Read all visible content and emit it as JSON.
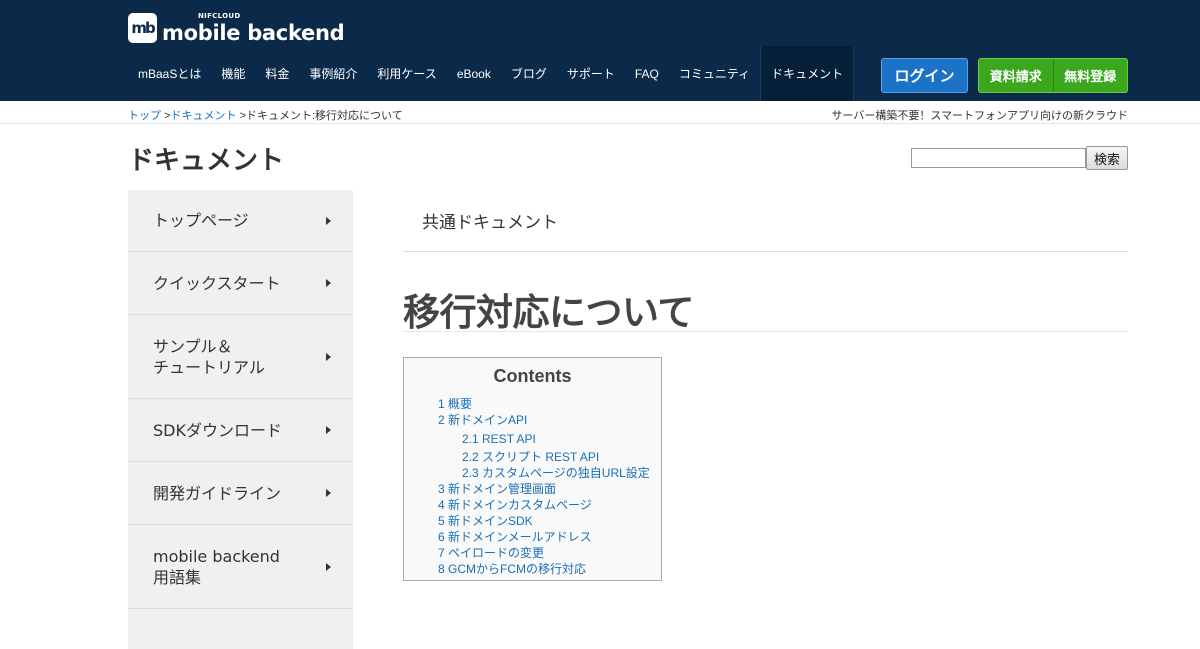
{
  "header": {
    "logo_mark": "mb",
    "logo_small": "NIFCLOUD",
    "logo_big": "mobile backend",
    "nav": [
      {
        "label": "mBaaSとは"
      },
      {
        "label": "機能"
      },
      {
        "label": "料金"
      },
      {
        "label": "事例紹介"
      },
      {
        "label": "利用ケース"
      },
      {
        "label": "eBook"
      },
      {
        "label": "ブログ"
      },
      {
        "label": "サポート"
      },
      {
        "label": "FAQ"
      },
      {
        "label": "コミュニティ"
      },
      {
        "label": "ドキュメント",
        "active": true
      }
    ],
    "login_label": "ログイン",
    "request_label": "資料請求",
    "signup_label": "無料登録"
  },
  "breadcrumb": {
    "items": [
      "トップ",
      "ドキュメント",
      "ドキュメント:移行対応について"
    ],
    "separator": ">",
    "tagline": "サーバー構築不要！スマートフォンアプリ向けの新クラウド"
  },
  "page": {
    "title": "ドキュメント",
    "search_button": "検索",
    "search_value": ""
  },
  "sidebar": {
    "items": [
      {
        "label": "トップページ"
      },
      {
        "label": "クイックスタート"
      },
      {
        "label": "サンプル＆\nチュートリアル"
      },
      {
        "label": "SDKダウンロード"
      },
      {
        "label": "開発ガイドライン"
      },
      {
        "label": "mobile backend\n用語集"
      },
      {
        "label": ""
      }
    ]
  },
  "main": {
    "section_label": "共通ドキュメント",
    "article_title": "移行対応について",
    "toc": {
      "title": "Contents",
      "items": [
        {
          "label": "1 概要"
        },
        {
          "label": "2 新ドメインAPI"
        },
        {
          "label": "2.1 REST API"
        },
        {
          "label": "2.2 スクリプト REST API"
        },
        {
          "label": "2.3 カスタムページの独自URL設定"
        },
        {
          "label": "3 新ドメイン管理画面"
        },
        {
          "label": "4 新ドメインカスタムページ"
        },
        {
          "label": "5 新ドメインSDK"
        },
        {
          "label": "6 新ドメインメールアドレス"
        },
        {
          "label": "7 ペイロードの変更"
        },
        {
          "label": "8 GCMからFCMの移行対応"
        }
      ]
    }
  },
  "colors": {
    "header_bg": "#0b2a4a",
    "link": "#1a6fb5",
    "login_blue": "#1a73c6",
    "signup_green": "#3aa71d"
  }
}
